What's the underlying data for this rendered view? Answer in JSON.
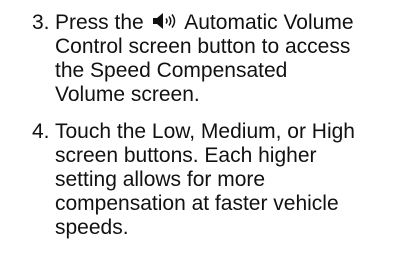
{
  "steps": [
    {
      "number": "3.",
      "icon": "speaker-volume-icon",
      "lines": [
        {
          "before": "Press the",
          "after": "Automatic Volume"
        },
        {
          "text": "Control screen button to access"
        },
        {
          "text": "the Speed Compensated"
        },
        {
          "text": "Volume screen."
        }
      ]
    },
    {
      "number": "4.",
      "lines": [
        {
          "text": "Touch the Low, Medium, or High"
        },
        {
          "text": "screen buttons. Each higher"
        },
        {
          "text": "setting allows for more"
        },
        {
          "text": "compensation at faster vehicle"
        },
        {
          "text": "speeds."
        }
      ]
    }
  ]
}
